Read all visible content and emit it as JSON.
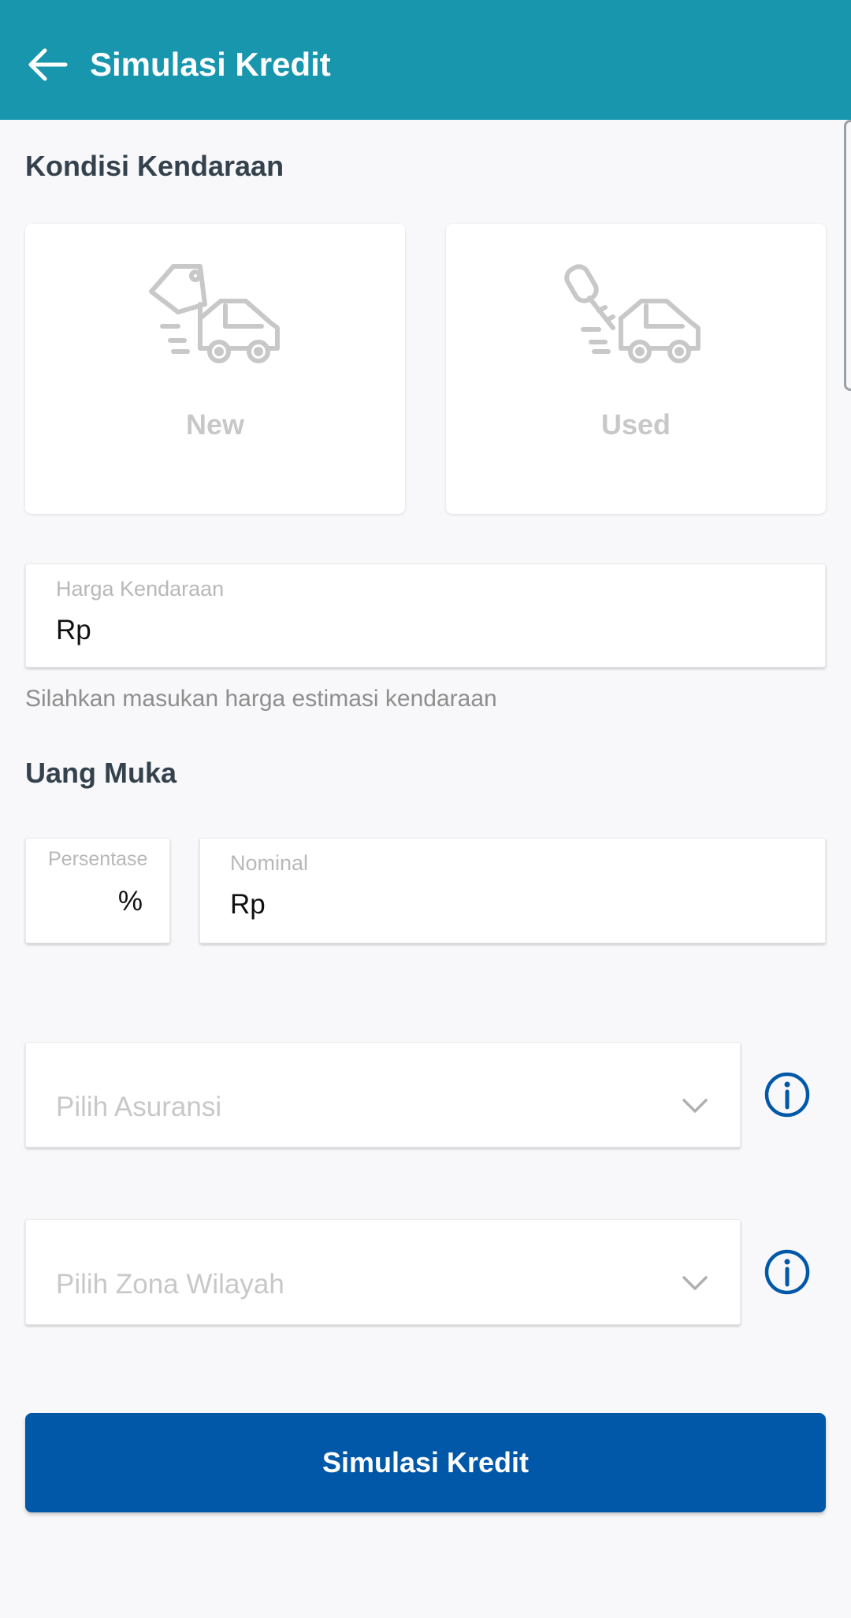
{
  "appbar": {
    "title": "Simulasi Kredit",
    "back_icon": "arrow-left-icon",
    "bg_color": "#1896ad"
  },
  "vehicle_condition": {
    "title": "Kondisi Kendaraan",
    "options": [
      {
        "label": "New",
        "icon": "car-price-tag-icon"
      },
      {
        "label": "Used",
        "icon": "car-key-icon"
      }
    ]
  },
  "price": {
    "label": "Harga Kendaraan",
    "prefix": "Rp",
    "helper": "Silahkan masukan harga estimasi kendaraan"
  },
  "down_payment": {
    "title": "Uang Muka",
    "percentage_label": "Persentase",
    "percentage_suffix": "%",
    "nominal_label": "Nominal",
    "nominal_prefix": "Rp"
  },
  "insurance": {
    "placeholder": "Pilih Asuransi",
    "info_icon": "info-icon"
  },
  "zone": {
    "placeholder": "Pilih Zona Wilayah",
    "info_icon": "info-icon"
  },
  "submit": {
    "label": "Simulasi Kredit",
    "color": "#0158a8"
  }
}
